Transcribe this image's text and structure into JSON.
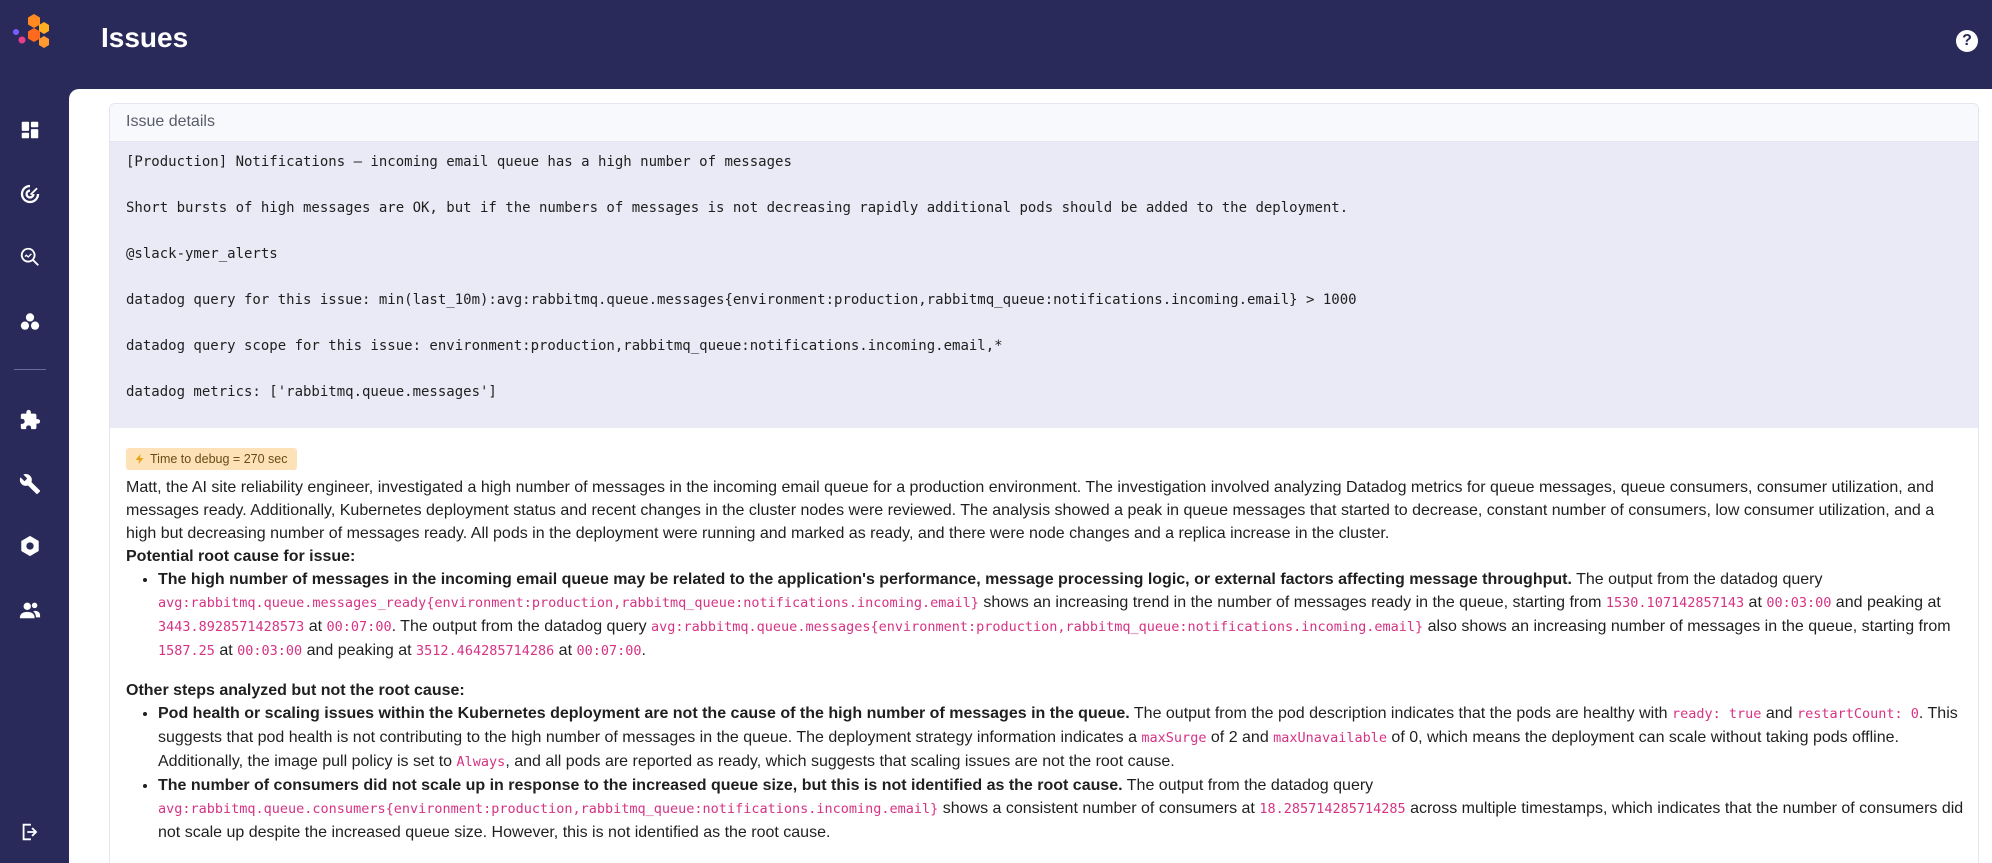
{
  "header": {
    "title": "Issues",
    "help_icon": "?"
  },
  "sidebar": {
    "items": [
      {
        "name": "dashboard-icon"
      },
      {
        "name": "radar-icon"
      },
      {
        "name": "search-analytics-icon"
      },
      {
        "name": "cluster-icon"
      },
      {
        "name": "puzzle-icon"
      },
      {
        "name": "wrench-icon"
      },
      {
        "name": "gear-icon"
      },
      {
        "name": "users-icon"
      },
      {
        "name": "logout-icon"
      }
    ]
  },
  "card": {
    "header": "Issue details",
    "lines": [
      "[Production] Notifications – incoming email queue has a high number of messages",
      "Short bursts of high messages are OK, but if the numbers of messages is not decreasing rapidly additional pods should be added to the deployment.",
      "@slack-ymer_alerts",
      "datadog query for this issue: min(last_10m):avg:rabbitmq.queue.messages{environment:production,rabbitmq_queue:notifications.incoming.email} > 1000",
      "datadog query scope for this issue: environment:production,rabbitmq_queue:notifications.incoming.email,*",
      "datadog metrics: ['rabbitmq.queue.messages']"
    ],
    "badge": "Time to debug = 270 sec",
    "summary": "Matt, the AI site reliability engineer, investigated a high number of messages in the incoming email queue for a production environment. The investigation involved analyzing Datadog metrics for queue messages, queue consumers, consumer utilization, and messages ready. Additionally, Kubernetes deployment status and recent changes in the cluster nodes were reviewed. The analysis showed a peak in queue messages that started to decrease, constant number of consumers, low consumer utilization, and a high but decreasing number of messages ready. All pods in the deployment were running and marked as ready, and there were node changes and a replica increase in the cluster.",
    "root_cause_title": "Potential root cause for issue:",
    "root_cause": {
      "bold": "The high number of messages in the incoming email queue may be related to the application's performance, message processing logic, or external factors affecting message throughput.",
      "t1": " The output from the datadog query ",
      "c1": "avg:rabbitmq.queue.messages_ready{environment:production,rabbitmq_queue:notifications.incoming.email}",
      "t2": " shows an increasing trend in the number of messages ready in the queue, starting from ",
      "c2": "1530.107142857143",
      "t3": " at ",
      "c3": "00:03:00",
      "t4": " and peaking at ",
      "c4": "3443.8928571428573",
      "t5": " at ",
      "c5": "00:07:00",
      "t6": ". The output from the datadog query ",
      "c6": "avg:rabbitmq.queue.messages{environment:production,rabbitmq_queue:notifications.incoming.email}",
      "t7": " also shows an increasing number of messages in the queue, starting from ",
      "c7": "1587.25",
      "t8": " at ",
      "c8": "00:03:00",
      "t9": " and peaking at ",
      "c9": "3512.464285714286",
      "t10": " at ",
      "c10": "00:07:00",
      "t11": "."
    },
    "other_title": "Other steps analyzed but not the root cause:",
    "other1": {
      "bold": "Pod health or scaling issues within the Kubernetes deployment are not the cause of the high number of messages in the queue.",
      "t1": " The output from the pod description indicates that the pods are healthy with ",
      "c1": "ready: true",
      "t2": " and ",
      "c2": "restartCount: 0",
      "t3": ". This suggests that pod health is not contributing to the high number of messages in the queue. The deployment strategy information indicates a ",
      "c3": "maxSurge",
      "t4": " of 2 and ",
      "c4": "maxUnavailable",
      "t5": " of 0, which means the deployment can scale without taking pods offline. Additionally, the image pull policy is set to ",
      "c5": "Always",
      "t6": ", and all pods are reported as ready, which suggests that scaling issues are not the root cause."
    },
    "other2": {
      "bold": "The number of consumers did not scale up in response to the increased queue size, but this is not identified as the root cause.",
      "t1": " The output from the datadog query ",
      "c1": "avg:rabbitmq.queue.consumers{environment:production,rabbitmq_queue:notifications.incoming.email}",
      "t2": " shows a consistent number of consumers at ",
      "c2": "18.285714285714285",
      "t3": " across multiple timestamps, which indicates that the number of consumers did not scale up despite the increased queue size. However, this is not identified as the root cause."
    }
  }
}
